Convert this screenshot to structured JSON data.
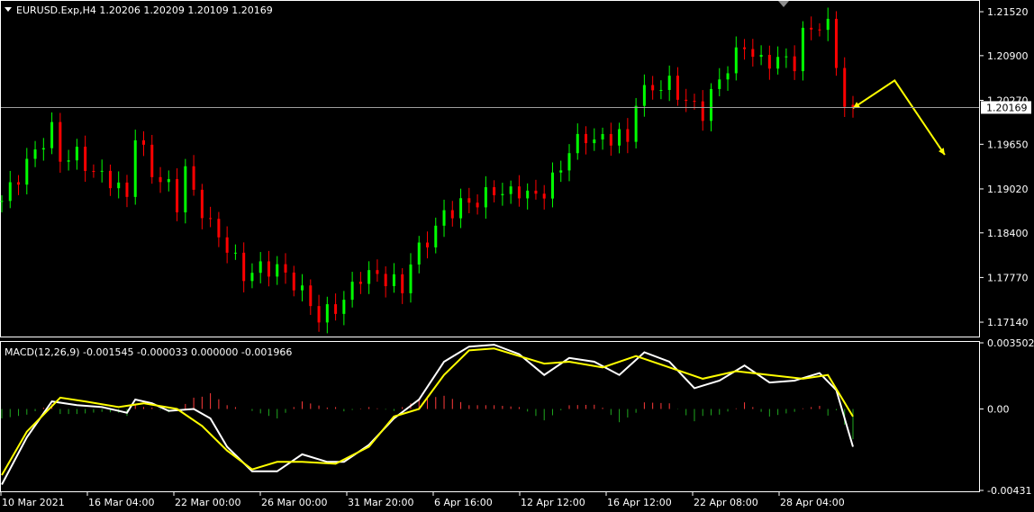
{
  "symbol_header": "EURUSD.Exp,H4  1.20206 1.20209 1.20109 1.20169",
  "macd_header": "MACD(12,26,9) -0.001545 -0.000033 0.000000 -0.001966",
  "current_price_label": "1.20169",
  "colors": {
    "background": "#000000",
    "grid_frame": "#ffffff",
    "bull_candle": "#00ff00",
    "bear_candle": "#ff0000",
    "macd_main": "#ffffff",
    "macd_signal": "#ffff00",
    "hist_positive": "#ff3b3b",
    "hist_negative": "#1fa81f",
    "arrow": "#ffff00"
  },
  "icons": {
    "dropdown": "triangle-down-icon",
    "shift_marker": "triangle-down-icon"
  },
  "chart_data": [
    {
      "type": "candlestick",
      "title": "EURUSD.Exp,H4",
      "ohlc_last": {
        "open": 1.20206,
        "high": 1.20209,
        "low": 1.20109,
        "close": 1.20169
      },
      "price_ticks": [
        "1.21520",
        "1.20900",
        "1.20270",
        "1.20169",
        "1.19650",
        "1.19020",
        "1.18400",
        "1.17770",
        "1.17140"
      ],
      "ylim": [
        1.1695,
        1.2166
      ],
      "time_ticks": [
        "10 Mar 2021",
        "16 Mar 04:00",
        "22 Mar 00:00",
        "26 Mar 00:00",
        "31 Mar 20:00",
        "6 Apr 16:00",
        "12 Apr 12:00",
        "16 Apr 12:00",
        "22 Apr 08:00",
        "28 Apr 04:00"
      ],
      "close_path": [
        [
          0,
          1.1885
        ],
        [
          2,
          1.192
        ],
        [
          4,
          1.1955
        ],
        [
          6,
          1.1985
        ],
        [
          7,
          1.1945
        ],
        [
          9,
          1.195
        ],
        [
          11,
          1.1925
        ],
        [
          13,
          1.1915
        ],
        [
          15,
          1.189
        ],
        [
          16,
          1.198
        ],
        [
          18,
          1.1925
        ],
        [
          20,
          1.1905
        ],
        [
          21,
          1.188
        ],
        [
          22,
          1.193
        ],
        [
          23,
          1.1895
        ],
        [
          25,
          1.185
        ],
        [
          27,
          1.182
        ],
        [
          29,
          1.178
        ],
        [
          31,
          1.179
        ],
        [
          33,
          1.179
        ],
        [
          35,
          1.177
        ],
        [
          37,
          1.174
        ],
        [
          38,
          1.172
        ],
        [
          40,
          1.1735
        ],
        [
          41,
          1.1745
        ],
        [
          43,
          1.178
        ],
        [
          45,
          1.178
        ],
        [
          47,
          1.177
        ],
        [
          48,
          1.176
        ],
        [
          49,
          1.18
        ],
        [
          51,
          1.183
        ],
        [
          53,
          1.1865
        ],
        [
          55,
          1.188
        ],
        [
          57,
          1.1885
        ],
        [
          59,
          1.19
        ],
        [
          61,
          1.1895
        ],
        [
          62,
          1.19
        ],
        [
          64,
          1.189
        ],
        [
          65,
          1.19
        ],
        [
          67,
          1.193
        ],
        [
          68,
          1.196
        ],
        [
          70,
          1.1975
        ],
        [
          72,
          1.197
        ],
        [
          74,
          1.198
        ],
        [
          75,
          1.1965
        ],
        [
          76,
          1.203
        ],
        [
          78,
          1.2045
        ],
        [
          80,
          1.205
        ],
        [
          82,
          1.2025
        ],
        [
          84,
          1.201
        ],
        [
          85,
          1.2035
        ],
        [
          87,
          1.2075
        ],
        [
          89,
          1.2105
        ],
        [
          91,
          1.208
        ],
        [
          93,
          1.2085
        ],
        [
          95,
          1.208
        ],
        [
          96,
          1.212
        ],
        [
          98,
          1.2135
        ],
        [
          99,
          1.213
        ],
        [
          100,
          1.208
        ],
        [
          101,
          1.202
        ],
        [
          102,
          1.2016
        ]
      ],
      "projection_arrow": [
        [
          102,
          1.2016
        ],
        [
          107,
          1.2055
        ],
        [
          113,
          1.195
        ]
      ],
      "total_bars": 103
    },
    {
      "type": "line",
      "title": "MACD(12,26,9)",
      "values_last": {
        "main": -0.001545,
        "signal": -3.3e-05,
        "histogram": 0.0,
        "extra": -0.001966
      },
      "y_ticks": [
        "0.003502",
        "0.00",
        "-0.00431"
      ],
      "ylim": [
        -0.00431,
        0.003502
      ],
      "series": [
        {
          "name": "MACD",
          "values": [
            [
              0,
              -0.004
            ],
            [
              3,
              -0.0015
            ],
            [
              6,
              0.0004
            ],
            [
              9,
              0.0002
            ],
            [
              12,
              0.0001
            ],
            [
              15,
              -0.0002
            ],
            [
              16,
              0.0005
            ],
            [
              18,
              0.0003
            ],
            [
              20,
              -0.0001
            ],
            [
              23,
              0.0
            ],
            [
              25,
              -0.0005
            ],
            [
              27,
              -0.002
            ],
            [
              30,
              -0.0033
            ],
            [
              33,
              -0.0033
            ],
            [
              36,
              -0.0024
            ],
            [
              39,
              -0.0028
            ],
            [
              41,
              -0.0028
            ],
            [
              44,
              -0.0019
            ],
            [
              47,
              -0.0005
            ],
            [
              50,
              0.0005
            ],
            [
              53,
              0.0025
            ],
            [
              56,
              0.0033
            ],
            [
              59,
              0.0034
            ],
            [
              62,
              0.0029
            ],
            [
              65,
              0.0018
            ],
            [
              68,
              0.0027
            ],
            [
              71,
              0.0025
            ],
            [
              74,
              0.0018
            ],
            [
              77,
              0.003
            ],
            [
              80,
              0.0025
            ],
            [
              83,
              0.0011
            ],
            [
              86,
              0.0015
            ],
            [
              89,
              0.0023
            ],
            [
              92,
              0.0014
            ],
            [
              95,
              0.0015
            ],
            [
              98,
              0.0019
            ],
            [
              100,
              0.001
            ],
            [
              102,
              -0.002
            ]
          ]
        },
        {
          "name": "Signal",
          "values": [
            [
              0,
              -0.0035
            ],
            [
              3,
              -0.0012
            ],
            [
              7,
              0.0006
            ],
            [
              10,
              0.0004
            ],
            [
              14,
              0.0001
            ],
            [
              17,
              0.0003
            ],
            [
              21,
              0.0
            ],
            [
              24,
              -0.0009
            ],
            [
              27,
              -0.0022
            ],
            [
              30,
              -0.0032
            ],
            [
              33,
              -0.0028
            ],
            [
              36,
              -0.0028
            ],
            [
              40,
              -0.0029
            ],
            [
              44,
              -0.002
            ],
            [
              47,
              -0.0004
            ],
            [
              50,
              0.0
            ],
            [
              53,
              0.0018
            ],
            [
              56,
              0.0031
            ],
            [
              59,
              0.0032
            ],
            [
              62,
              0.0028
            ],
            [
              65,
              0.0024
            ],
            [
              68,
              0.0025
            ],
            [
              72,
              0.0022
            ],
            [
              76,
              0.0028
            ],
            [
              80,
              0.0022
            ],
            [
              84,
              0.0016
            ],
            [
              88,
              0.002
            ],
            [
              92,
              0.0018
            ],
            [
              96,
              0.0016
            ],
            [
              99,
              0.0018
            ],
            [
              102,
              -0.0004
            ]
          ]
        }
      ]
    }
  ]
}
